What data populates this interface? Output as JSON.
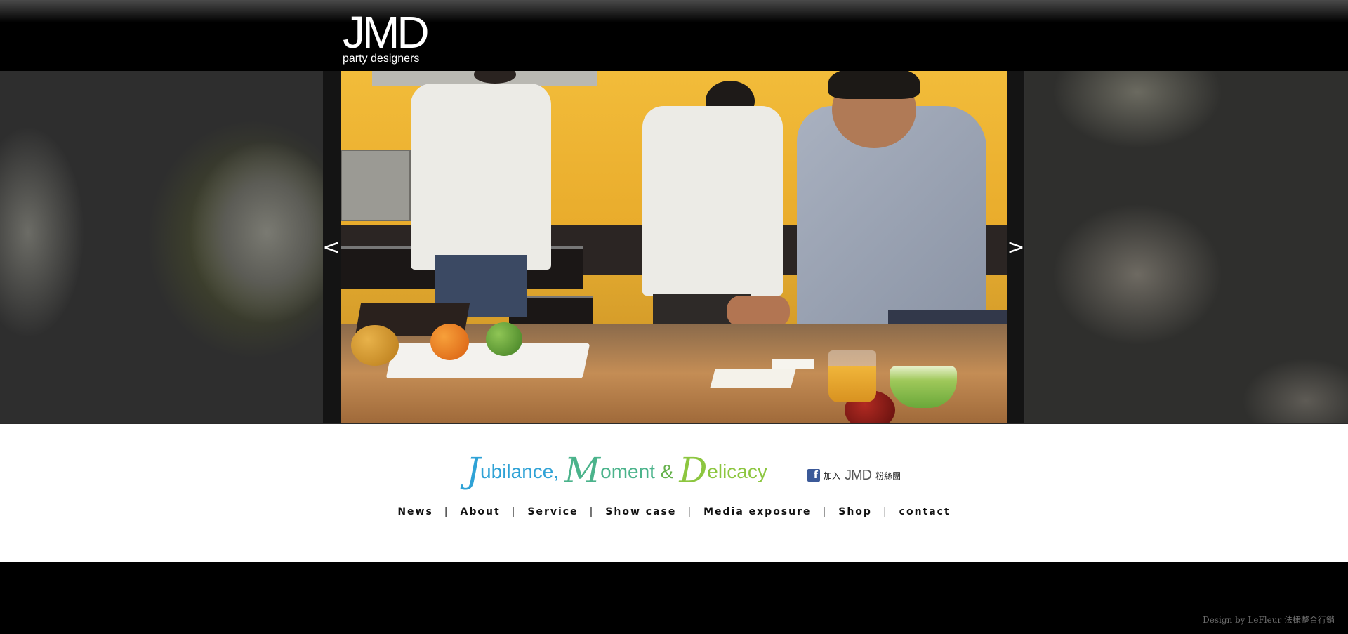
{
  "header": {
    "logo_main": "JMD",
    "logo_sub": "party designers"
  },
  "slider": {
    "prev_glyph": "<",
    "next_glyph": ">",
    "prev_icon": "chevron-left-icon",
    "next_icon": "chevron-right-icon"
  },
  "tagline": {
    "part1_cap": "J",
    "part1_rest": "ubilance, ",
    "part2_cap": "M",
    "part2_rest": "oment ",
    "amp": "& ",
    "part3_cap": "D",
    "part3_rest": "elicacy",
    "colors": {
      "jubilance": "#2fa2d6",
      "moment": "#4bb38b",
      "amp": "#64b04a",
      "delicacy": "#8cc63f"
    }
  },
  "facebook": {
    "icon": "facebook-icon",
    "prefix": "加入",
    "brand": "JMD",
    "suffix": "粉絲團"
  },
  "nav": {
    "items": [
      "News",
      "About",
      "Service",
      "Show case",
      "Media exposure",
      "Shop",
      "contact"
    ],
    "separator": "|"
  },
  "footer": {
    "credit": "Design by LeFleur 法棣整合行銷"
  }
}
